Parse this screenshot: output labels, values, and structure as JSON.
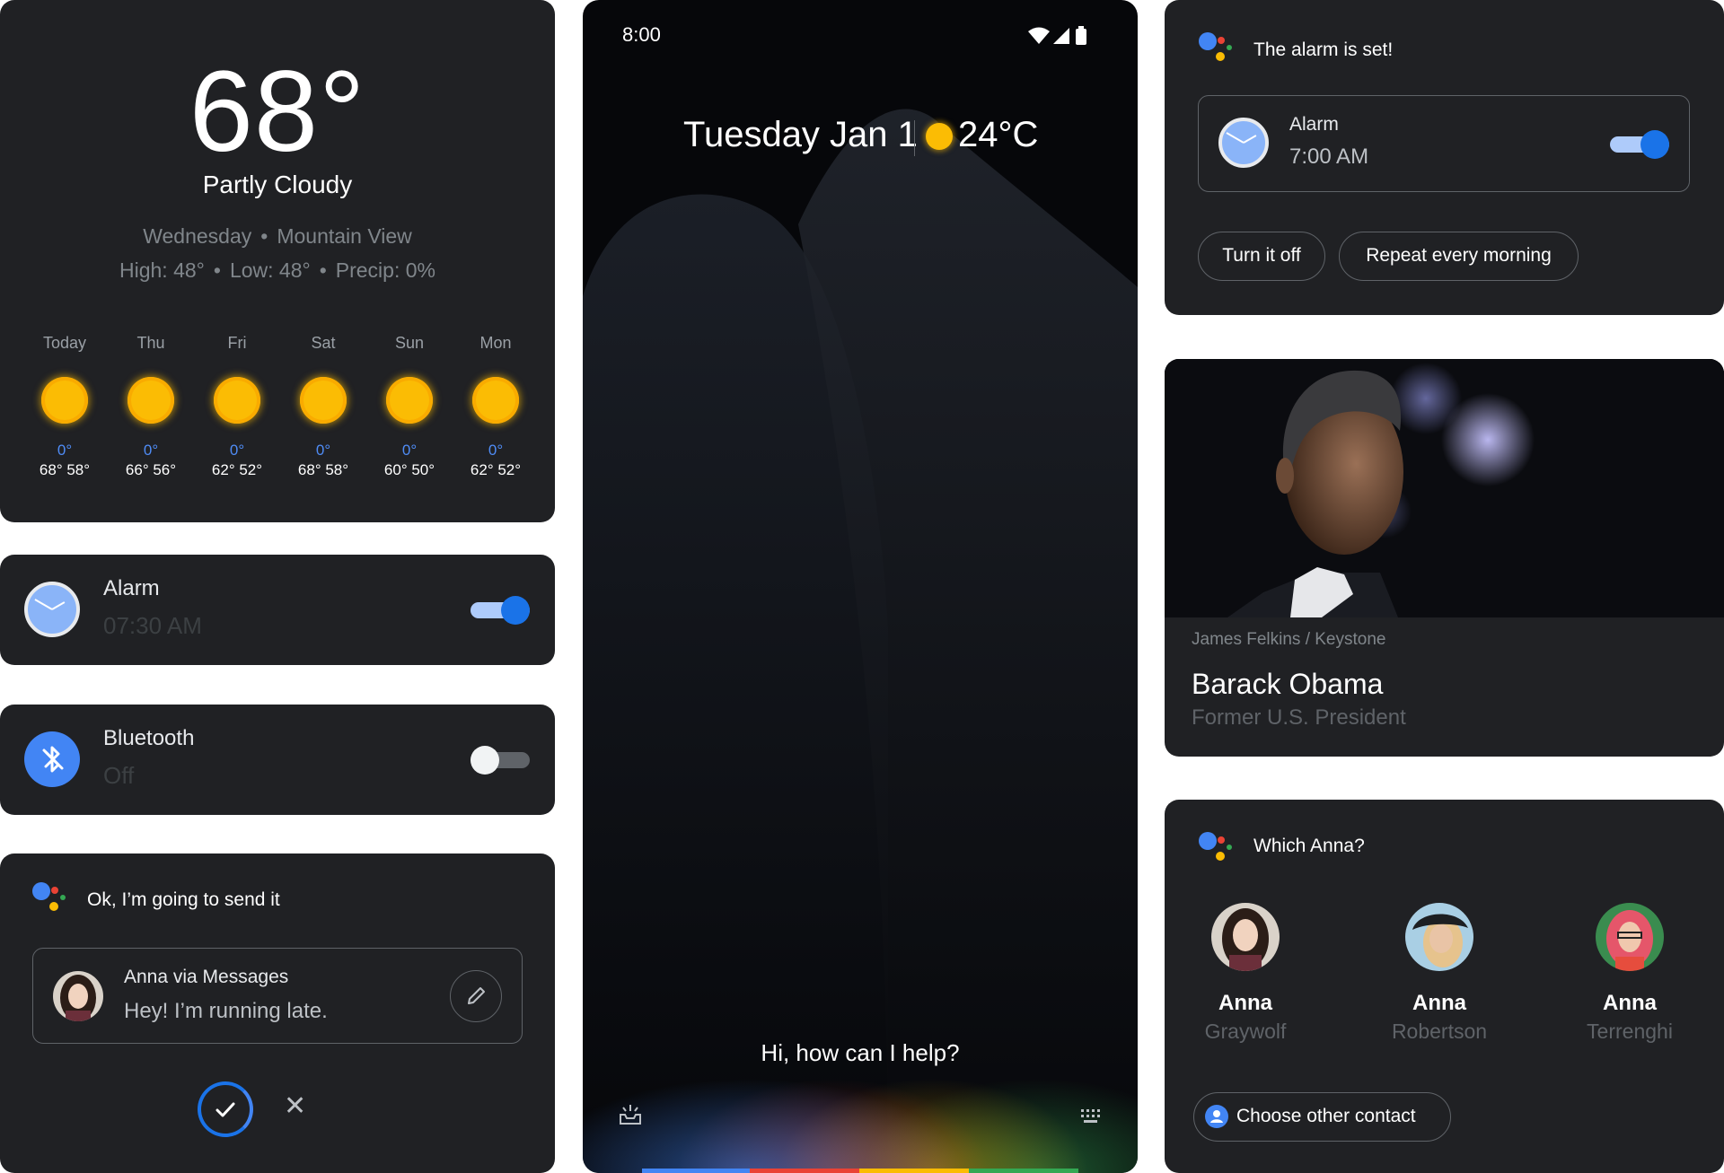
{
  "weather": {
    "temp": "68°",
    "condition": "Partly Cloudy",
    "day": "Wednesday",
    "location": "Mountain View",
    "high": "High: 48°",
    "low": "Low: 48°",
    "precip": "Precip: 0%",
    "separator": "•",
    "forecast": [
      {
        "day": "Today",
        "zero": "0°",
        "hilo": "68° 58°"
      },
      {
        "day": "Thu",
        "zero": "0°",
        "hilo": "66° 56°"
      },
      {
        "day": "Fri",
        "zero": "0°",
        "hilo": "62° 52°"
      },
      {
        "day": "Sat",
        "zero": "0°",
        "hilo": "68° 58°"
      },
      {
        "day": "Sun",
        "zero": "0°",
        "hilo": "60° 50°"
      },
      {
        "day": "Mon",
        "zero": "0°",
        "hilo": "62° 52°"
      }
    ]
  },
  "alarm_row": {
    "title": "Alarm",
    "time": "07:30 AM",
    "enabled": true
  },
  "bluetooth_row": {
    "title": "Bluetooth",
    "status": "Off",
    "enabled": false
  },
  "message_card": {
    "title": "Ok, I’m going to send it",
    "from": "Anna via Messages",
    "text": "Hey! I’m running late."
  },
  "phone": {
    "time": "8:00",
    "date": "Tuesday Jan 1",
    "temp": "24°C",
    "prompt": "Hi, how can I help?"
  },
  "alarm_set": {
    "title": "The alarm is set!",
    "label": "Alarm",
    "time": "7:00 AM",
    "enabled": true,
    "chips": [
      "Turn it off",
      "Repeat every morning"
    ]
  },
  "person": {
    "credit": "James  Felkins / Keystone",
    "name": "Barack Obama",
    "role": "Former U.S. President"
  },
  "contacts": {
    "title": "Which Anna?",
    "people": [
      {
        "first": "Anna",
        "last": "Graywolf"
      },
      {
        "first": "Anna",
        "last": "Robertson"
      },
      {
        "first": "Anna",
        "last": "Terrenghi"
      }
    ],
    "other_label": "Choose other contact"
  },
  "colors": {
    "card_bg": "#202124",
    "accent_blue": "#1a73e8",
    "google_blue": "#4285f4",
    "google_red": "#ea4335",
    "google_yellow": "#fbbc04",
    "google_green": "#34a853"
  },
  "icons": [
    "sun-icon",
    "clock-icon",
    "bluetooth-icon",
    "assistant-icon",
    "pencil-icon",
    "check-icon",
    "close-icon",
    "wifi-icon",
    "signal-icon",
    "battery-icon",
    "tray-icon",
    "keyboard-icon",
    "person-icon"
  ]
}
